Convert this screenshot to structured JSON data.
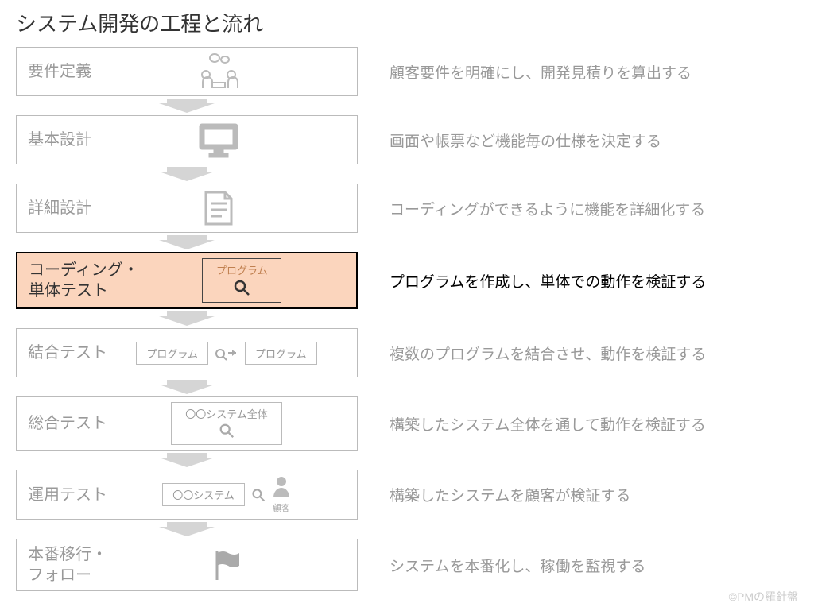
{
  "title": "システム開発の工程と流れ",
  "steps": [
    {
      "label": "要件定義",
      "desc": "顧客要件を明確にし、開発見積りを算出する",
      "highlight": false
    },
    {
      "label": "基本設計",
      "desc": "画面や帳票など機能毎の仕様を決定する",
      "highlight": false
    },
    {
      "label": "詳細設計",
      "desc": "コーディングができるように機能を詳細化する",
      "highlight": false
    },
    {
      "label": "コーディング・\n単体テスト",
      "desc": "プログラムを作成し、単体での動作を検証する",
      "highlight": true
    },
    {
      "label": "結合テスト",
      "desc": "複数のプログラムを結合させ、動作を検証する",
      "highlight": false
    },
    {
      "label": "総合テスト",
      "desc": "構築したシステム全体を通して動作を検証する",
      "highlight": false
    },
    {
      "label": "運用テスト",
      "desc": "構築したシステムを顧客が検証する",
      "highlight": false
    },
    {
      "label": "本番移行・\nフォロー",
      "desc": "システムを本番化し、稼働を監視する",
      "highlight": false
    }
  ],
  "mini": {
    "program": "プログラム",
    "system_whole": "〇〇システム全体",
    "system": "〇〇システム",
    "customer": "顧客"
  },
  "footer": "©PMの羅針盤"
}
